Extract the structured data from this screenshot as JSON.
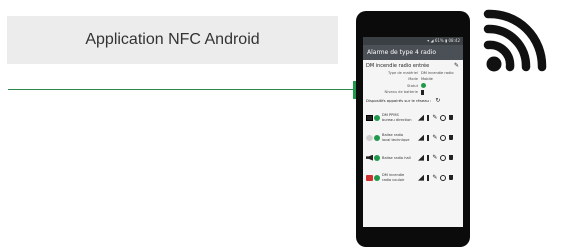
{
  "caption": "Application NFC Android",
  "phone": {
    "statusbar": "▾  ◢ 61% ▮ 08:42",
    "appbar_title": "Alarme de type 4 radio",
    "device_name": "DM incendie radio entrée",
    "attributes": [
      {
        "label": "Type de matériel",
        "value": "DM incendie radio"
      },
      {
        "label": "Mode",
        "value": "Mobile"
      },
      {
        "label": "Statut",
        "value": ""
      },
      {
        "label": "Niveau de batterie",
        "value": ""
      }
    ],
    "paired_label": "Dispositifs appairés sur le réseau :",
    "devices": [
      {
        "icon": "dark",
        "label": "DM PPMS bureau direction"
      },
      {
        "icon": "grey",
        "label": "Balise radio local technique"
      },
      {
        "icon": "speaker",
        "label": "Balise radio hall"
      },
      {
        "icon": "red",
        "label": "DM incendie radio couloir"
      }
    ]
  },
  "colors": {
    "accent": "#1f9a4a",
    "appbar": "#4a5056",
    "caption_bg": "#ececec"
  }
}
